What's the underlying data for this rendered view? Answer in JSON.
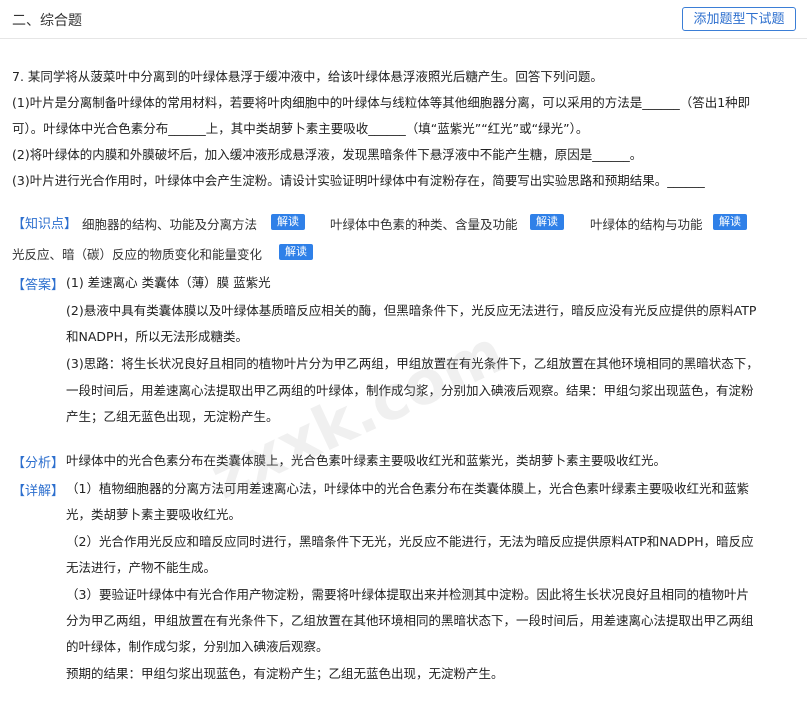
{
  "header": {
    "section_title": "二、综合题",
    "add_button": "添加题型下试题"
  },
  "question": {
    "line1": "7. 某同学将从菠菜叶中分离到的叶绿体悬浮于缓冲液中，给该叶绿体悬浮液照光后糖产生。回答下列问题。",
    "line2": "(1)叶片是分离制备叶绿体的常用材料，若要将叶肉细胞中的叶绿体与线粒体等其他细胞器分离，可以采用的方法是______（答出1种即",
    "line3": "可）。叶绿体中光合色素分布______上，其中类胡萝卜素主要吸收______（填“蓝紫光”“红光”或“绿光”）。",
    "line4": "(2)将叶绿体的内膜和外膜破坏后，加入缓冲液形成悬浮液，发现黑暗条件下悬浮液中不能产生糖，原因是______。",
    "line5": "(3)叶片进行光合作用时，叶绿体中会产生淀粉。请设计实验证明叶绿体中有淀粉存在，简要写出实验思路和预期结果。______"
  },
  "knowledge": {
    "label": "【知识点】",
    "items": [
      "细胞器的结构、功能及分离方法",
      "叶绿体中色素的种类、含量及功能",
      "叶绿体的结构与功能",
      "光反应、暗（碳）反应的物质变化和能量变化"
    ],
    "btn_label": "解读"
  },
  "answer": {
    "label": "【答案】",
    "l1": "(1)    差速离心    类囊体（薄）膜    蓝紫光",
    "l2": "(2)悬液中具有类囊体膜以及叶绿体基质暗反应相关的酶，但黑暗条件下，光反应无法进行，暗反应没有光反应提供的原料ATP",
    "l3": "和NADPH，所以无法形成糖类。",
    "l4": "(3)思路：将生长状况良好且相同的植物叶片分为甲乙两组，甲组放置在有光条件下，乙组放置在其他环境相同的黑暗状态下，",
    "l5": "一段时间后，用差速离心法提取出甲乙两组的叶绿体，制作成匀浆，分别加入碘液后观察。结果：甲组匀浆出现蓝色，有淀粉",
    "l6": "产生；乙组无蓝色出现，无淀粉产生。"
  },
  "analysis": {
    "label": "【分析】",
    "text": "叶绿体中的光合色素分布在类囊体膜上，光合色素叶绿素主要吸收红光和蓝紫光，类胡萝卜素主要吸收红光。"
  },
  "detail": {
    "label": "【详解】",
    "l1": "（1）植物细胞器的分离方法可用差速离心法，叶绿体中的光合色素分布在类囊体膜上，光合色素叶绿素主要吸收红光和蓝紫",
    "l2": "光，类胡萝卜素主要吸收红光。",
    "l3": "（2）光合作用光反应和暗反应同时进行，黑暗条件下无光，光反应不能进行，无法为暗反应提供原料ATP和NADPH，暗反应",
    "l4": "无法进行，产物不能生成。",
    "l5": "（3）要验证叶绿体中有光合作用产物淀粉，需要将叶绿体提取出来并检测其中淀粉。因此将生长状况良好且相同的植物叶片",
    "l6": "分为甲乙两组，甲组放置在有光条件下，乙组放置在其他环境相同的黑暗状态下，一段时间后，用差速离心法提取出甲乙两组",
    "l7": "的叶绿体，制作成匀浆，分别加入碘液后观察。",
    "l8": "预期的结果：甲组匀浆出现蓝色，有淀粉产生；乙组无蓝色出现，无淀粉产生。"
  },
  "watermark": "zxxk.com"
}
